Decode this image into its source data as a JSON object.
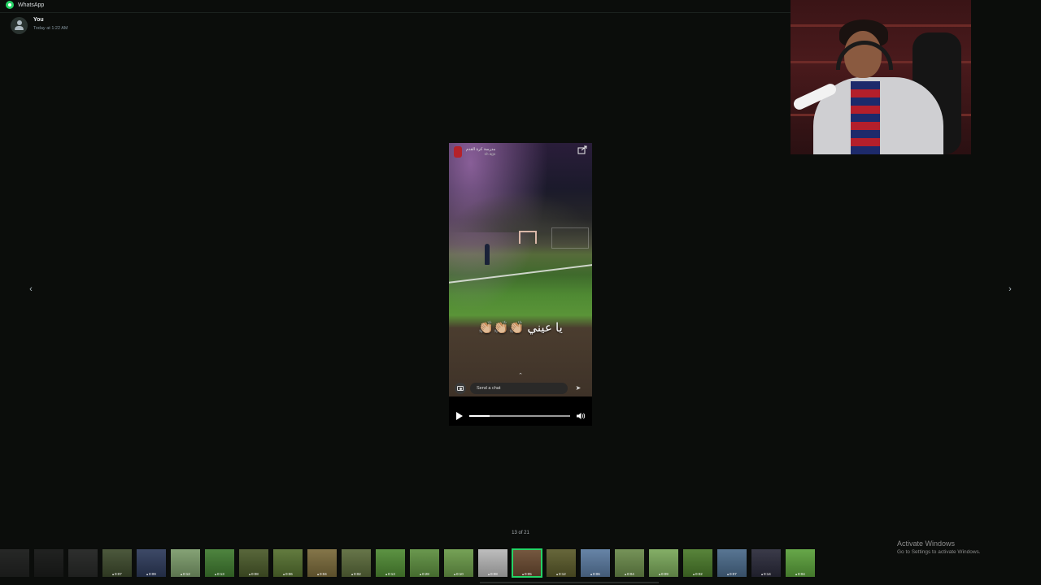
{
  "titlebar": {
    "app_name": "WhatsApp"
  },
  "sender": {
    "name": "You",
    "time": "Today at 1:22 AM"
  },
  "navigation": {
    "prev_icon": "chevron-left-icon",
    "next_icon": "chevron-right-icon",
    "prev_glyph": "‹",
    "next_glyph": "›"
  },
  "story": {
    "username": "مدرسة كرة القدم",
    "age": "1h ago",
    "caption": "يا عيني 👏🏼👏🏼👏🏼",
    "chat_placeholder": "Send a chat",
    "send_glyph": "➤",
    "chevron_glyph": "⌃"
  },
  "player": {
    "progress": 0.2
  },
  "counter": "13 of 21",
  "thumbnails": [
    {
      "duration": "",
      "bg": "#3a3a3a",
      "dim": true
    },
    {
      "duration": "",
      "bg": "#2c2c2c",
      "dim": true
    },
    {
      "duration": "",
      "bg": "#4a4a4a",
      "dim": true
    },
    {
      "duration": "0:07",
      "bg": "#3d4a2c"
    },
    {
      "duration": "0:09",
      "bg": "#2d3a5a"
    },
    {
      "duration": "0:12",
      "bg": "#7b9b6a"
    },
    {
      "duration": "0:13",
      "bg": "#3f7a2f"
    },
    {
      "duration": "0:08",
      "bg": "#4a5a2a"
    },
    {
      "duration": "0:06",
      "bg": "#55702f"
    },
    {
      "duration": "0:04",
      "bg": "#7a6a3a"
    },
    {
      "duration": "0:02",
      "bg": "#5a6a3a"
    },
    {
      "duration": "0:13",
      "bg": "#4f8a33"
    },
    {
      "duration": "0:28",
      "bg": "#5d8f3f"
    },
    {
      "duration": "0:10",
      "bg": "#6a9a48"
    },
    {
      "duration": "0:08",
      "bg": "#b8b8b8"
    },
    {
      "duration": "0:05",
      "bg": "#6a4a30",
      "active": true
    },
    {
      "duration": "0:12",
      "bg": "#5a5a2a"
    },
    {
      "duration": "0:06",
      "bg": "#5a7aa0"
    },
    {
      "duration": "0:04",
      "bg": "#6a8a4a"
    },
    {
      "duration": "0:09",
      "bg": "#7aa85a"
    },
    {
      "duration": "0:02",
      "bg": "#4a7a2a"
    },
    {
      "duration": "0:07",
      "bg": "#4a6a8a"
    },
    {
      "duration": "0:14",
      "bg": "#2a2a3a"
    },
    {
      "duration": "0:04",
      "bg": "#5aa03a"
    }
  ],
  "watermark": {
    "title": "Activate Windows",
    "subtitle": "Go to Settings to activate Windows."
  },
  "colors": {
    "accent": "#25d366",
    "background": "#0b0d0b"
  }
}
